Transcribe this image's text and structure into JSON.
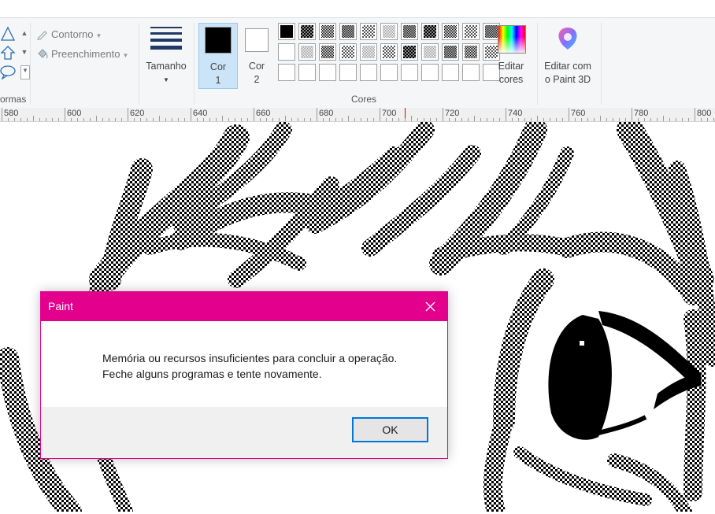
{
  "ribbon": {
    "shapes": {
      "group_label": "ormas",
      "outline_label": "Contorno",
      "fill_label": "Preenchimento"
    },
    "size": {
      "label": "Tamanho"
    },
    "color1": {
      "line1": "Cor",
      "line2": "1",
      "color": "#000000"
    },
    "color2": {
      "line1": "Cor",
      "line2": "2",
      "color": "#ffffff"
    },
    "colors_group_label": "Cores",
    "edit_colors": {
      "line1": "Editar",
      "line2": "cores"
    },
    "paint3d": {
      "line1": "Editar com",
      "line2": "o Paint 3D"
    }
  },
  "ruler": {
    "labels": [
      "580",
      "600",
      "620",
      "640",
      "660",
      "680",
      "700",
      "720",
      "740",
      "760",
      "780",
      "800"
    ]
  },
  "dialog": {
    "title": "Paint",
    "message_line1": "Memória ou recursos insuficientes para concluir a operação.",
    "message_line2": "Feche alguns programas e tente novamente.",
    "ok_label": "OK",
    "accent_color": "#e3008c"
  }
}
